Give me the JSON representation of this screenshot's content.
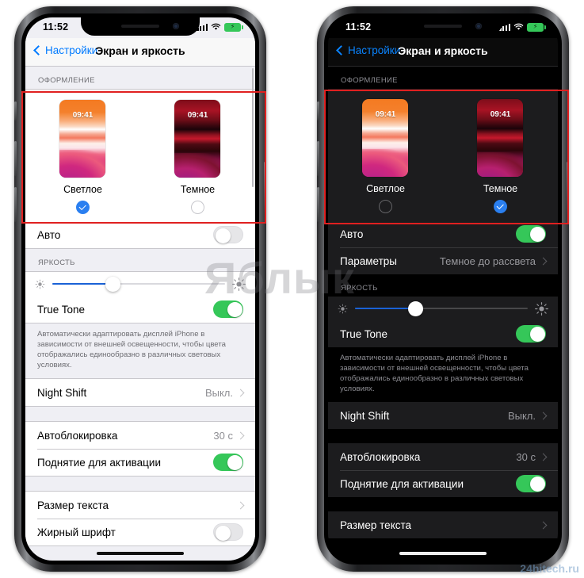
{
  "statusbar": {
    "time": "11:52",
    "battery_icon": "battery-charging-icon",
    "wifi_icon": "wifi-icon",
    "signal_icon": "cellular-signal-icon",
    "bolt": "⚡"
  },
  "nav": {
    "back_label": "Настройки",
    "title": "Экран и яркость"
  },
  "sections": {
    "appearance_header": "ОФОРМЛЕНИЕ",
    "brightness_header": "ЯРКОСТЬ"
  },
  "themes": {
    "light": {
      "name": "Светлое",
      "thumb_time": "09:41"
    },
    "dark": {
      "name": "Темное",
      "thumb_time": "09:41"
    }
  },
  "left_phone": {
    "appearance_selected": "light",
    "auto_label": "Авто",
    "auto_on": false,
    "brightness_percent": 35,
    "true_tone_label": "True Tone",
    "true_tone_on": true,
    "true_tone_footnote": "Автоматически адаптировать дисплей iPhone в зависимости от внешней освещенности, чтобы цвета отображались единообразно в различных световых условиях.",
    "night_shift_label": "Night Shift",
    "night_shift_value": "Выкл.",
    "autolock_label": "Автоблокировка",
    "autolock_value": "30 с",
    "raise_label": "Поднятие для активации",
    "raise_on": true,
    "textsize_label": "Размер текста",
    "bold_label": "Жирный шрифт"
  },
  "right_phone": {
    "appearance_selected": "dark",
    "auto_label": "Авто",
    "auto_on": true,
    "params_label": "Параметры",
    "params_value": "Темное до рассвета",
    "brightness_percent": 35,
    "true_tone_label": "True Tone",
    "true_tone_on": true,
    "true_tone_footnote": "Автоматически адаптировать дисплей iPhone в зависимости от внешней освещенности, чтобы цвета отображались единообразно в различных световых условиях.",
    "night_shift_label": "Night Shift",
    "night_shift_value": "Выкл.",
    "autolock_label": "Автоблокировка",
    "autolock_value": "30 с",
    "raise_label": "Поднятие для активации",
    "raise_on": true,
    "textsize_label": "Размер текста"
  },
  "watermarks": {
    "center": "Яблык",
    "bottom_right": "24hitech.ru"
  },
  "colors": {
    "accent_blue": "#007aff",
    "toggle_green": "#35c759",
    "highlight_red": "#e02020",
    "slider_blue": "#1a62d6"
  }
}
